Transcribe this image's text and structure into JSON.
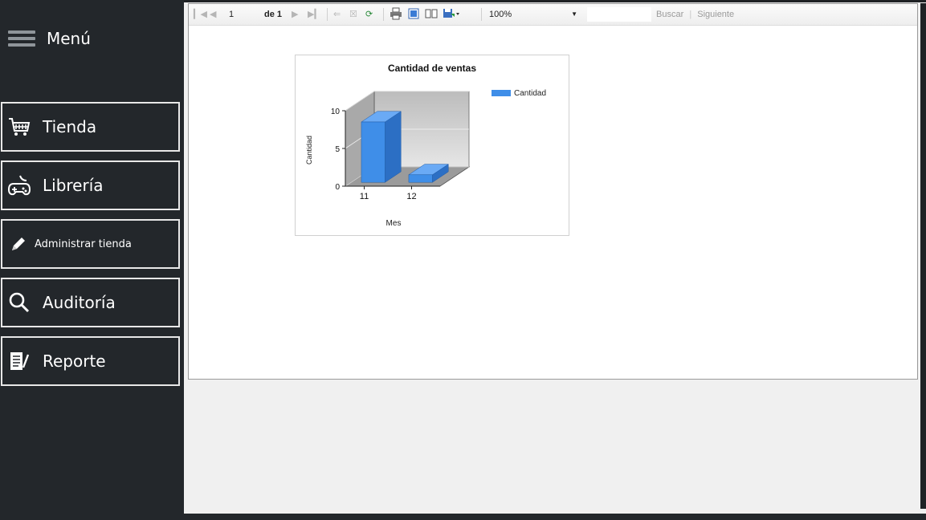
{
  "sidebar": {
    "menu_label": "Menú",
    "items": [
      {
        "label": "Tienda",
        "icon": "cart-icon"
      },
      {
        "label": "Librería",
        "icon": "gamepad-icon"
      },
      {
        "label": "Administrar tienda",
        "icon": "pencil-icon"
      },
      {
        "label": "Auditoría",
        "icon": "search-icon"
      },
      {
        "label": "Reporte",
        "icon": "report-icon"
      }
    ]
  },
  "toolbar": {
    "page_current": "1",
    "page_of": "de 1",
    "zoom": "100%",
    "find_label": "Buscar",
    "find_separator": "|",
    "next_label": "Siguiente"
  },
  "chart_data": {
    "type": "bar",
    "title": "Cantidad de ventas",
    "xlabel": "Mes",
    "ylabel": "Cantidad",
    "categories": [
      "11",
      "12"
    ],
    "series": [
      {
        "name": "Cantidad",
        "values": [
          8,
          1
        ]
      }
    ],
    "ylim": [
      0,
      10
    ],
    "yticks": [
      0,
      5,
      10
    ],
    "legend_position": "top-right",
    "style": "3d",
    "color": "#3f8ee8"
  }
}
